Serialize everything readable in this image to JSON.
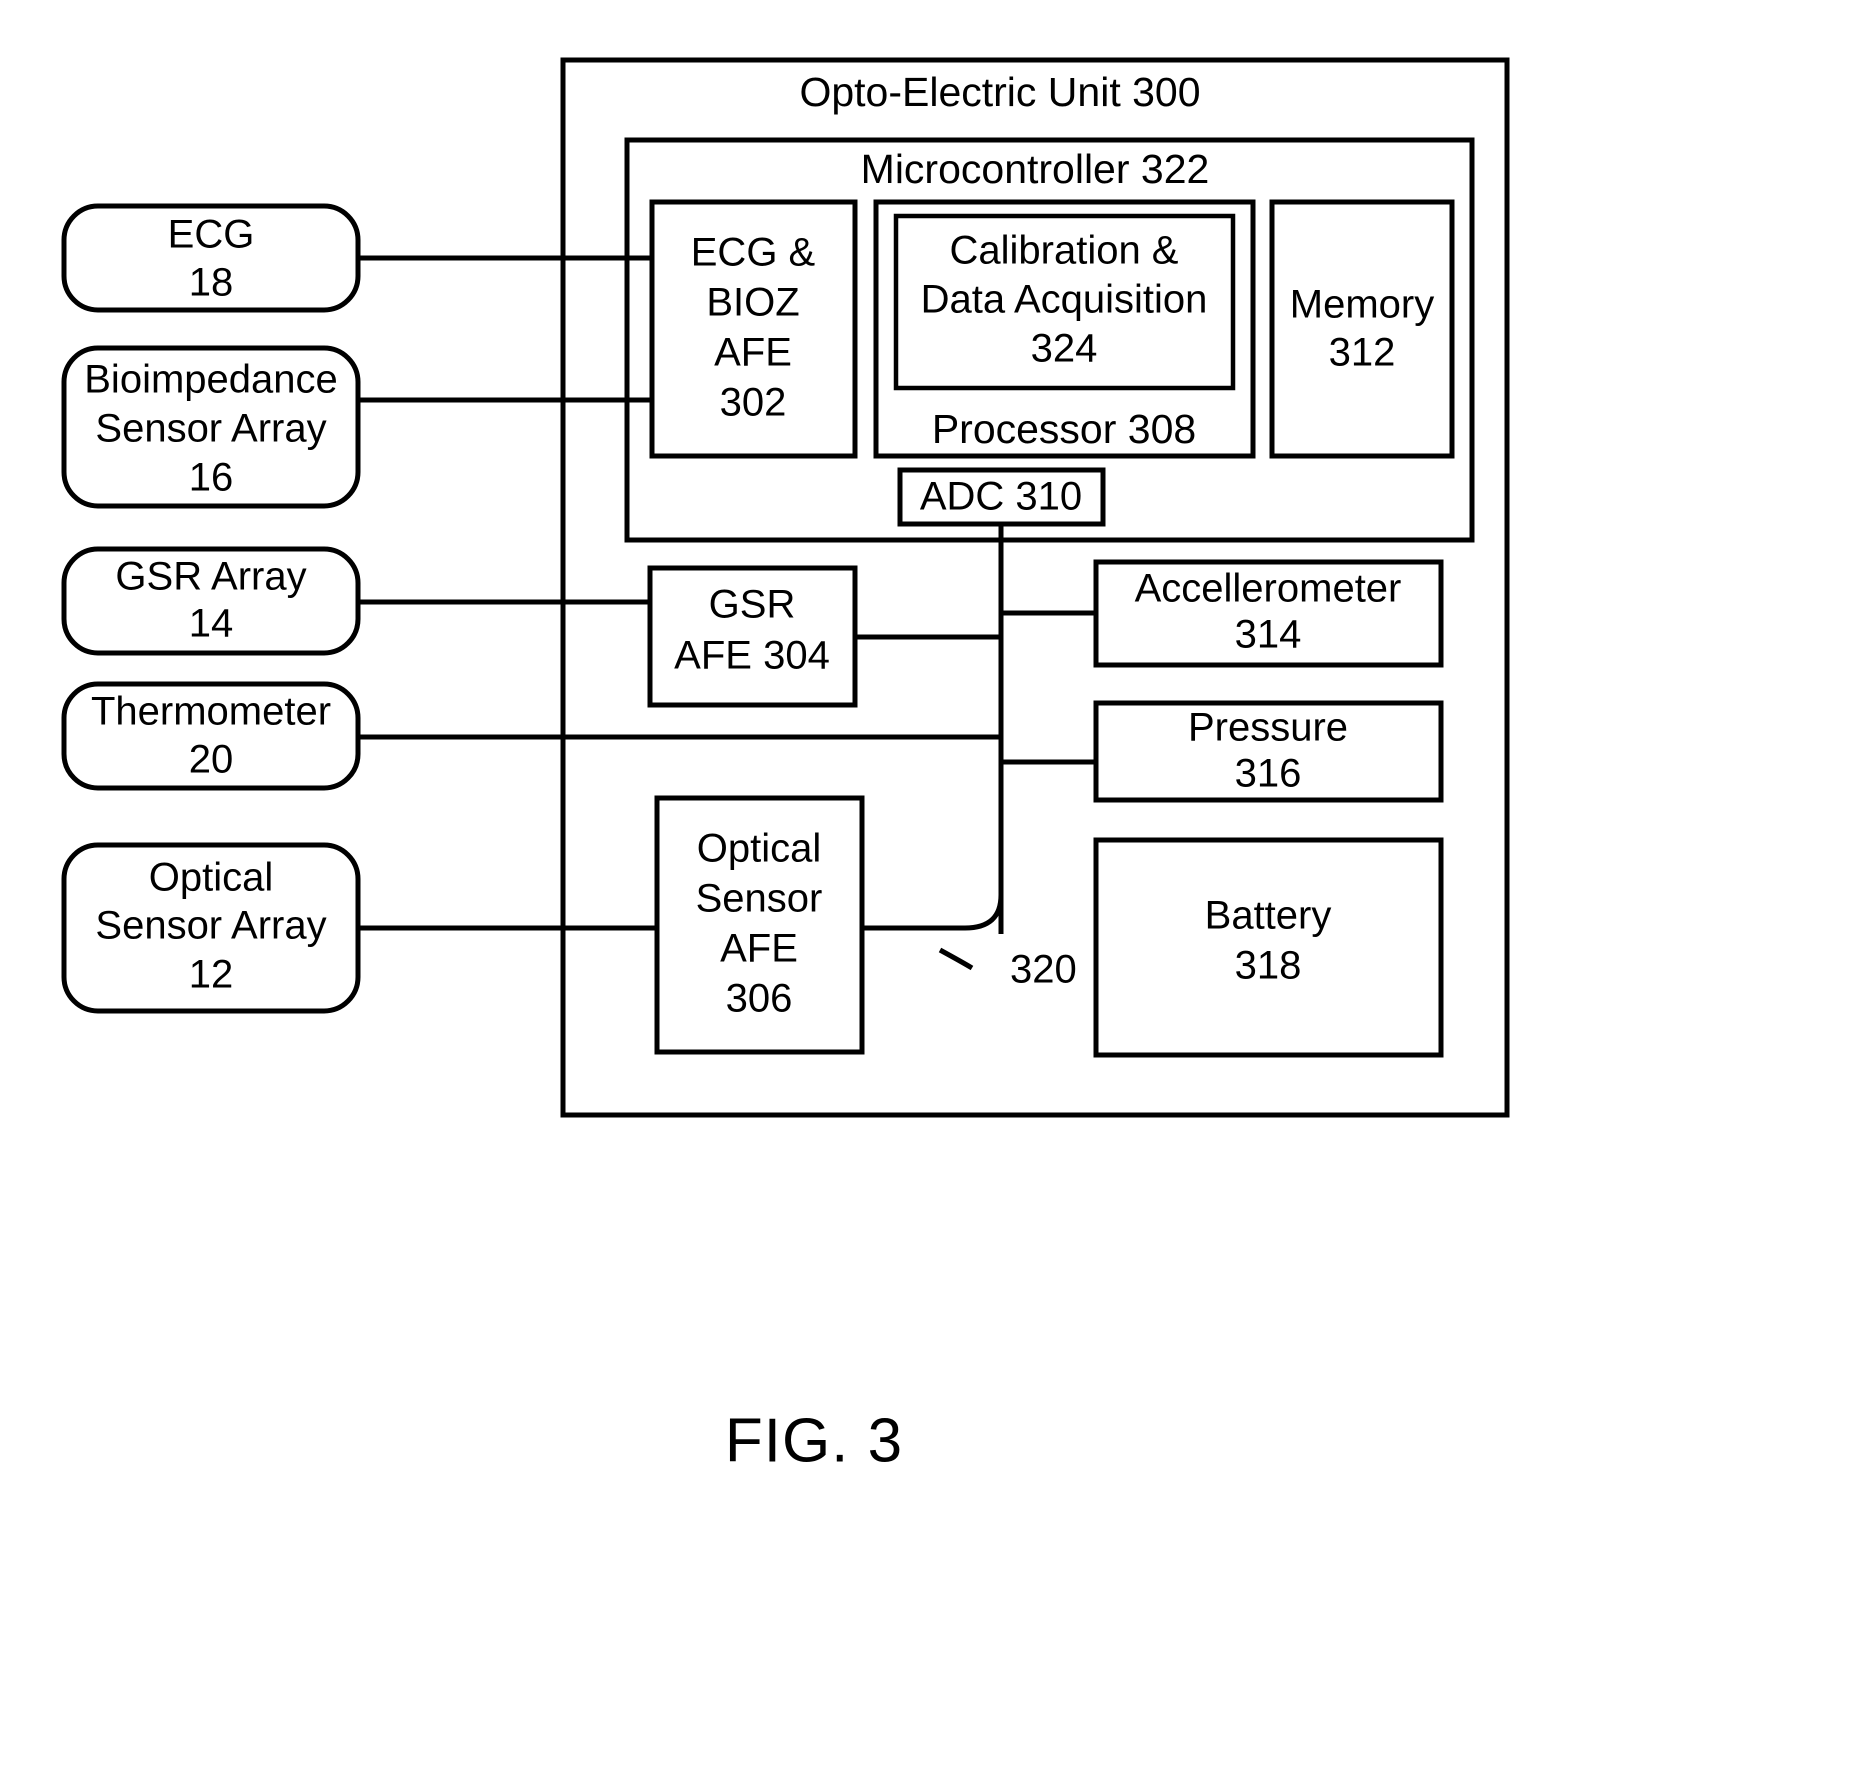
{
  "figure": {
    "caption": "FIG. 3",
    "title": "Opto-Electric Unit 300"
  },
  "containers": {
    "opto_electric_unit": "Opto-Electric Unit 300",
    "microcontroller": "Microcontroller 322",
    "processor": "Processor 308"
  },
  "sensors": [
    {
      "id": "ecg",
      "lines": [
        "ECG",
        "18"
      ]
    },
    {
      "id": "bioimpedance",
      "lines": [
        "Bioimpedance",
        "Sensor Array",
        "16"
      ]
    },
    {
      "id": "gsr_array",
      "lines": [
        "GSR Array",
        "14"
      ]
    },
    {
      "id": "thermometer",
      "lines": [
        "Thermometer",
        "20"
      ]
    },
    {
      "id": "optical_array",
      "lines": [
        "Optical",
        "Sensor Array",
        "12"
      ]
    }
  ],
  "afe_blocks": [
    {
      "id": "ecg_bioz_afe",
      "lines": [
        "ECG &",
        "BIOZ",
        "AFE",
        "302"
      ]
    },
    {
      "id": "gsr_afe",
      "lines": [
        "GSR",
        "AFE 304"
      ]
    },
    {
      "id": "optical_afe",
      "lines": [
        "Optical",
        "Sensor",
        "AFE",
        "306"
      ]
    }
  ],
  "mcu_blocks": [
    {
      "id": "calibration_data_acq",
      "lines": [
        "Calibration &",
        "Data Acquisition",
        "324"
      ]
    },
    {
      "id": "memory",
      "lines": [
        "Memory",
        "312"
      ]
    },
    {
      "id": "adc",
      "lines": [
        "ADC 310"
      ]
    }
  ],
  "peripherals": [
    {
      "id": "accelerometer",
      "lines": [
        "Accellerometer",
        "314"
      ]
    },
    {
      "id": "pressure",
      "lines": [
        "Pressure",
        "316"
      ]
    },
    {
      "id": "battery",
      "lines": [
        "Battery",
        "318"
      ]
    }
  ],
  "reference_labels": [
    {
      "id": "bus_320",
      "text": "320"
    }
  ],
  "colors": {
    "stroke": "#000000",
    "background": "#ffffff",
    "text": "#000000"
  }
}
